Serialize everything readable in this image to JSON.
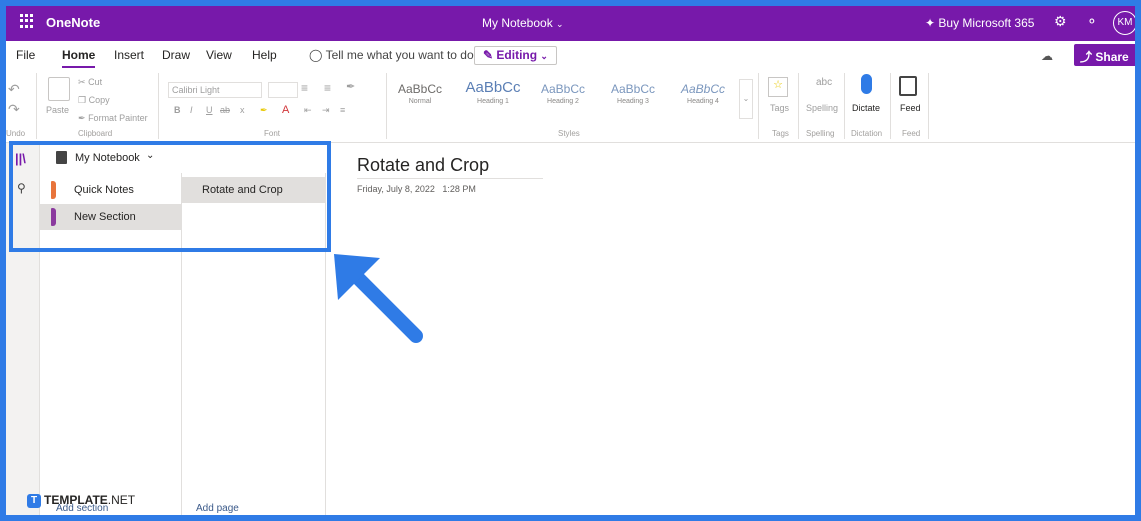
{
  "titlebar": {
    "app_name": "OneNote",
    "notebook_title": "My Notebook",
    "buy_label": "Buy Microsoft 365",
    "user_initials": "KM"
  },
  "tabs": {
    "items": [
      "File",
      "Home",
      "Insert",
      "Draw",
      "View",
      "Help"
    ],
    "active": "Home",
    "tell_me": "Tell me what you want to do",
    "editing_label": "Editing",
    "share_label": "Share"
  },
  "ribbon": {
    "undo_group": "Undo",
    "paste_label": "Paste",
    "cut_label": "Cut",
    "copy_label": "Copy",
    "format_painter_label": "Format Painter",
    "clipboard_group": "Clipboard",
    "font_name": "Calibri Light",
    "font_group": "Font",
    "font_buttons": [
      "B",
      "I",
      "U",
      "ab",
      "x"
    ],
    "styles": [
      {
        "preview": "AaBbCc",
        "name": "Normal"
      },
      {
        "preview": "AaBbCc",
        "name": "Heading 1"
      },
      {
        "preview": "AaBbCc",
        "name": "Heading 2"
      },
      {
        "preview": "AaBbCc",
        "name": "Heading 3"
      },
      {
        "preview": "AaBbCc",
        "name": "Heading 4"
      }
    ],
    "styles_group": "Styles",
    "tags_label": "Tags",
    "tags_group": "Tags",
    "spelling_label": "Spelling",
    "spelling_abc": "abc",
    "spelling_group": "Spelling",
    "dictate_label": "Dictate",
    "dictation_group": "Dictation",
    "feed_label": "Feed",
    "feed_group": "Feed"
  },
  "navigation": {
    "notebook_name": "My Notebook",
    "sections": [
      {
        "name": "Quick Notes",
        "color": "#e8743b"
      },
      {
        "name": "New Section",
        "color": "#8b3a9e"
      }
    ],
    "active_section": "New Section",
    "pages": [
      "Rotate and Crop"
    ],
    "add_section": "Add section",
    "add_page": "Add page"
  },
  "canvas": {
    "page_title": "Rotate and Crop",
    "date": "Friday, July 8, 2022",
    "time": "1:28 PM"
  },
  "watermark": {
    "brand": "TEMPLATE",
    "suffix": ".NET"
  },
  "colors": {
    "brand_purple": "#7719aa",
    "highlight_blue": "#2f7be6"
  }
}
